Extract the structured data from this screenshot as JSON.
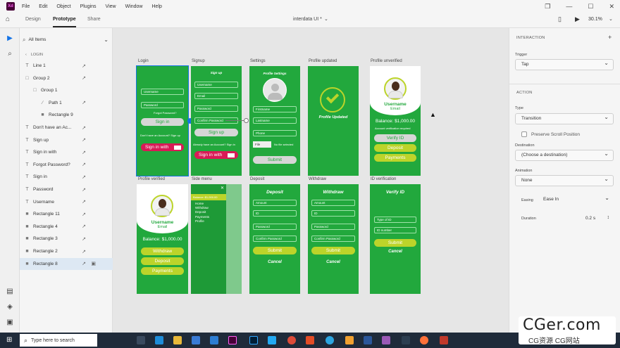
{
  "app": {
    "logo": "Xd",
    "document_title": "interdata UI *",
    "zoom": "30.1%"
  },
  "menu": [
    "File",
    "Edit",
    "Object",
    "Plugins",
    "View",
    "Window",
    "Help"
  ],
  "mode_tabs": [
    "Design",
    "Prototype",
    "Share"
  ],
  "layers": {
    "filter_label": "All Items",
    "breadcrumb": "LOGIN",
    "items": [
      {
        "type": "text",
        "name": "Line 1",
        "indent": 0,
        "link": true
      },
      {
        "type": "group",
        "name": "Group 2",
        "indent": 0,
        "link": true
      },
      {
        "type": "group",
        "name": "Group 1",
        "indent": 1,
        "link": false
      },
      {
        "type": "path",
        "name": "Path 1",
        "indent": 2,
        "link": true
      },
      {
        "type": "rect",
        "name": "Rectangle 9",
        "indent": 2,
        "link": false
      },
      {
        "type": "text",
        "name": "Don't have an Ac...",
        "indent": 0,
        "link": true
      },
      {
        "type": "text",
        "name": "Sign up",
        "indent": 0,
        "link": true
      },
      {
        "type": "text",
        "name": "Sign in with",
        "indent": 0,
        "link": true
      },
      {
        "type": "text",
        "name": "Forgot Password?",
        "indent": 0,
        "link": true
      },
      {
        "type": "text",
        "name": "Sign in",
        "indent": 0,
        "link": true
      },
      {
        "type": "text",
        "name": "Password",
        "indent": 0,
        "link": true
      },
      {
        "type": "text",
        "name": "Username",
        "indent": 0,
        "link": true
      },
      {
        "type": "rect",
        "name": "Rectangle 11",
        "indent": 0,
        "link": true
      },
      {
        "type": "rect",
        "name": "Rectangle 4",
        "indent": 0,
        "link": true
      },
      {
        "type": "rect",
        "name": "Rectangle 3",
        "indent": 0,
        "link": true
      },
      {
        "type": "rect",
        "name": "Rectangle 2",
        "indent": 0,
        "link": true
      },
      {
        "type": "rect",
        "name": "Rectangle 8",
        "indent": 0,
        "link": true,
        "locked": true,
        "selected": true
      }
    ]
  },
  "artboards": {
    "login": {
      "label": "Login",
      "username": "Username",
      "password": "Password",
      "forgot": "Forgot Password?",
      "signin": "Sign in",
      "noaccount": "Don't have an Account? Sign up",
      "signin_with": "Sign in with"
    },
    "signup": {
      "label": "Signup",
      "header": "Sign up",
      "username": "Username",
      "email": "Email",
      "password": "Password",
      "confirm": "Confirm Password",
      "button": "Sign up",
      "has_account": "Already have an Account? Sign in",
      "signin_with": "Sign in with"
    },
    "settings": {
      "label": "Settings",
      "header": "Profile Settings",
      "firstname": "Firstname",
      "lastname": "Lastname",
      "phone": "Phone",
      "file": "File",
      "file_note": "No file selected",
      "submit": "Submit"
    },
    "profile_updated": {
      "label": "Profile updated",
      "text": "Profile Updated"
    },
    "profile_unverified": {
      "label": "Profile unverified",
      "username": "Username",
      "email": "Email",
      "balance": "Balance: $1,000.00",
      "note": "Account verification required",
      "verify": "Verify ID",
      "deposit": "Deposit",
      "payments": "Payments"
    },
    "profile_verified": {
      "label": "Profile verified",
      "username": "Username",
      "email": "Email",
      "balance": "Balance: $1,000.00",
      "withdraw": "Withdraw",
      "deposit": "Deposit",
      "payments": "Payments"
    },
    "side_menu": {
      "label": "Side menu",
      "balance": "Balance: $1,000.00",
      "items": [
        "Home",
        "Withdraw",
        "Deposit",
        "Payments",
        "Profile"
      ]
    },
    "deposit": {
      "label": "Deposit",
      "header": "Deposit",
      "amount": "Amount",
      "id": "ID",
      "password": "Password",
      "confirm": "Confirm Password",
      "submit": "Submit",
      "cancel": "Cancel"
    },
    "withdraw": {
      "label": "Withdraw",
      "header": "Withdraw",
      "amount": "Amount",
      "id": "ID",
      "password": "Password",
      "confirm": "Confirm Password",
      "submit": "Submit",
      "cancel": "Cancel"
    },
    "id_verification": {
      "label": "ID verification",
      "header": "Verify ID",
      "type": "Type of ID",
      "number": "ID number",
      "submit": "Submit",
      "cancel": "Cancel"
    }
  },
  "properties": {
    "interaction_title": "INTERACTION",
    "trigger_label": "Trigger",
    "trigger_value": "Tap",
    "action_title": "ACTION",
    "type_label": "Type",
    "type_value": "Transition",
    "preserve_scroll": "Preserve Scroll Position",
    "destination_label": "Destination",
    "destination_value": "(Choose a destination)",
    "animation_label": "Animation",
    "animation_value": "None",
    "easing_label": "Easing",
    "easing_value": "Ease In",
    "duration_label": "Duration",
    "duration_value": "0.2 s"
  },
  "taskbar": {
    "search_placeholder": "Type here to search"
  },
  "watermark": {
    "main": "CGer.com",
    "sub": "CG资源 CG网站"
  },
  "colors": {
    "green": "#22a83d",
    "lime": "#bcd42a",
    "pink": "#d81b56",
    "accent": "#1473e6"
  }
}
